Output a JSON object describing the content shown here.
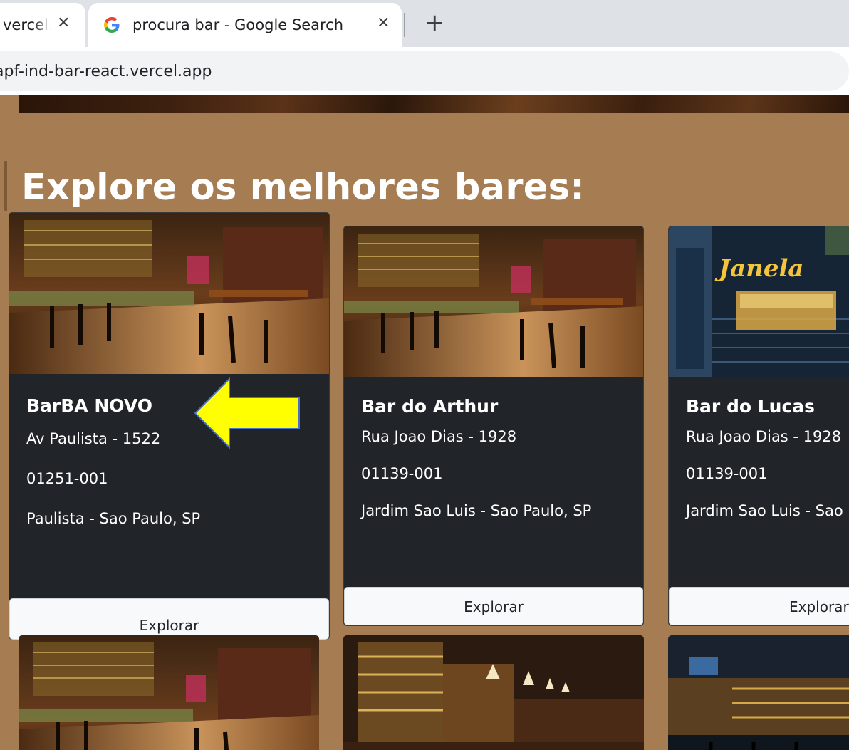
{
  "browser": {
    "tabs": [
      {
        "title": "vercel.app",
        "close": "✕",
        "active": false
      },
      {
        "title": "procura bar - Google Search",
        "close": "✕",
        "active": true
      }
    ],
    "new_tab": "+",
    "address": "apf-ind-bar-react.vercel.app"
  },
  "page": {
    "section_title": "Explore os melhores bares:",
    "cards": [
      {
        "name": "BarBA NOVO",
        "address": "Av Paulista - 1522",
        "cep": "01251-001",
        "district": "Paulista - Sao Paulo, SP",
        "button": "Explorar"
      },
      {
        "name": "Bar do Arthur",
        "address": "Rua Joao Dias - 1928",
        "cep": "01139-001",
        "district": "Jardim Sao Luis - Sao Paulo, SP",
        "button": "Explorar"
      },
      {
        "name": "Bar do Lucas",
        "address": "Rua Joao Dias - 1928",
        "cep": "01139-001",
        "district": "Jardim Sao Luis - Sao Paulo, SP",
        "button": "Explorar"
      }
    ],
    "sign_text": "Janela"
  },
  "colors": {
    "page_bg": "#a67c52",
    "card_bg": "#212529",
    "arrow_fill": "#ffff00",
    "arrow_stroke": "#4472c4"
  }
}
